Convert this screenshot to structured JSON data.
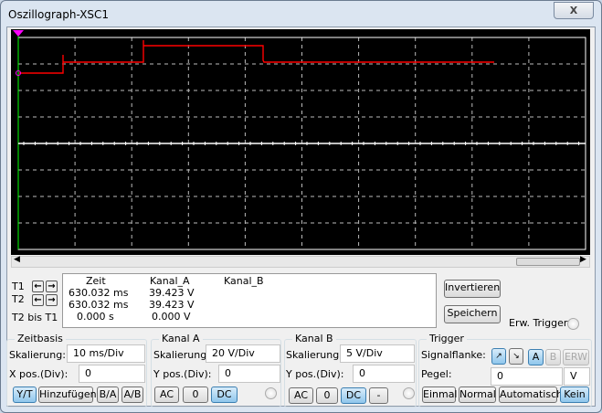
{
  "window": {
    "title": "Oszillograph-XSC1",
    "close": "X"
  },
  "cursor_panel": {
    "t1": "T1",
    "t2": "T2",
    "t2_t1": "T2 bis T1",
    "headers": [
      "Zeit",
      "Kanal_A",
      "Kanal_B"
    ],
    "rows": [
      [
        "630.032 ms",
        "39.423 V",
        ""
      ],
      [
        "630.032 ms",
        "39.423 V",
        ""
      ],
      [
        "0.000 s",
        "0.000 V",
        ""
      ]
    ]
  },
  "buttons": {
    "invert": "Invertieren",
    "save": "Speichern",
    "ext_trigger": "Erw. Trigger"
  },
  "timebase": {
    "title": "Zeitbasis",
    "scale_label": "Skalierung:",
    "scale": "10 ms/Div",
    "xpos_label": "X pos.(Div):",
    "xpos": "0",
    "modes": [
      "Y/T",
      "Hinzufügen",
      "B/A",
      "A/B"
    ],
    "active": "Y/T"
  },
  "channel_a": {
    "title": "Kanal A",
    "scale_label": "Skalierung:",
    "scale": "20  V/Div",
    "ypos_label": "Y pos.(Div):",
    "ypos": "0",
    "coupling": [
      "AC",
      "0",
      "DC"
    ],
    "active": "DC"
  },
  "channel_b": {
    "title": "Kanal B",
    "scale_label": "Skalierung:",
    "scale": "5  V/Div",
    "ypos_label": "Y pos.(Div):",
    "ypos": "0",
    "coupling": [
      "AC",
      "0",
      "DC",
      "-"
    ],
    "active": "DC"
  },
  "trigger": {
    "title": "Trigger",
    "edge_label": "Signalflanke:",
    "sources": [
      "A",
      "B",
      "ERW"
    ],
    "active_source": "A",
    "level_label": "Pegel:",
    "level": "0",
    "level_unit": "V",
    "modes": [
      "Einmal",
      "Normal",
      "Automatisch",
      "Kein"
    ],
    "active_mode": "Kein"
  },
  "colors": {
    "channel_a": "#ff0000",
    "channel_b": "#ffffff",
    "cursor": "#ff00ff"
  }
}
